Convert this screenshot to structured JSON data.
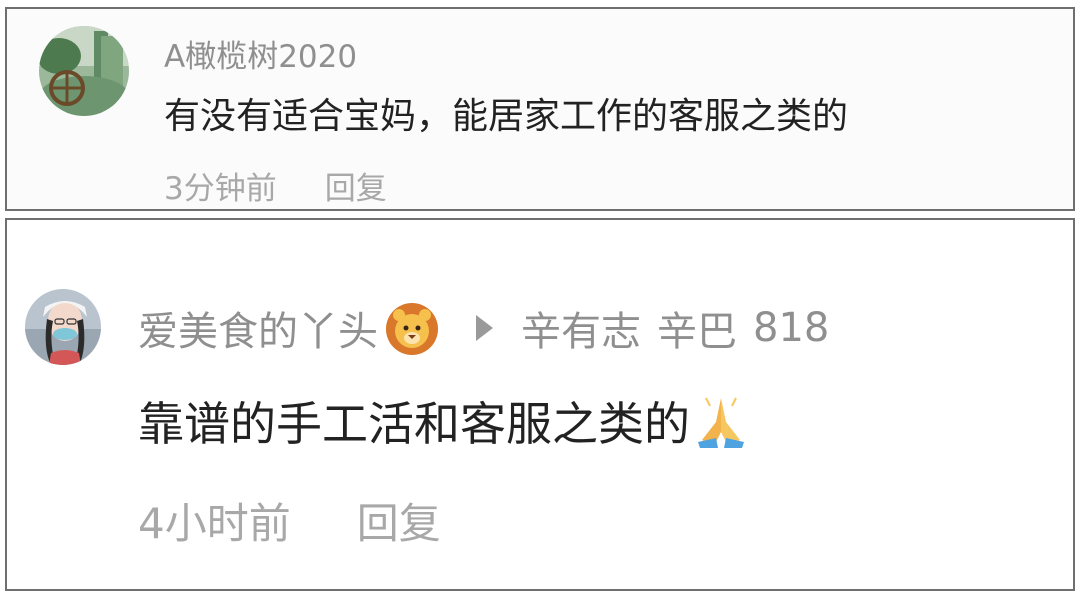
{
  "comments": [
    {
      "username": "A橄榄树2020",
      "text": "有没有适合宝妈，能居家工作的客服之类的",
      "time": "3分钟前",
      "reply_label": "回复"
    },
    {
      "username": "爱美食的丫头",
      "username_emoji": "lion-face-icon",
      "reply_to_1": "辛有志",
      "reply_to_2": "辛巴",
      "reply_to_3": "818",
      "text": "靠谱的手工活和客服之类的",
      "text_emoji": "folded-hands-icon",
      "time": "4小时前",
      "reply_label": "回复"
    }
  ]
}
